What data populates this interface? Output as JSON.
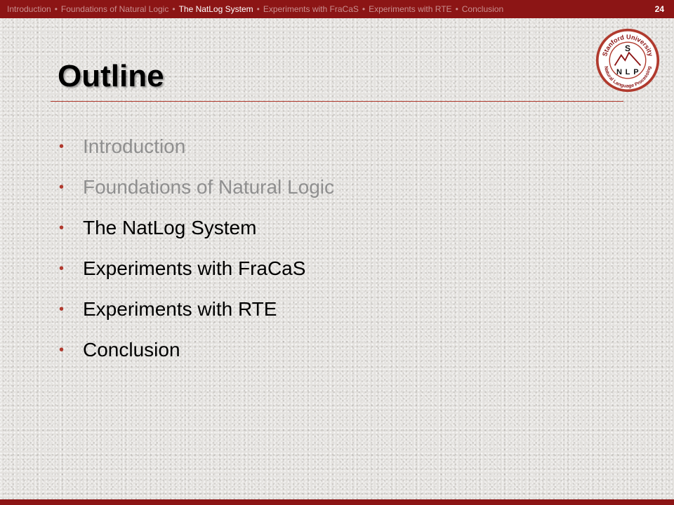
{
  "header": {
    "breadcrumbs": [
      {
        "label": "Introduction",
        "active": false
      },
      {
        "label": "Foundations of Natural Logic",
        "active": false
      },
      {
        "label": "The NatLog System",
        "active": true
      },
      {
        "label": "Experiments with FraCaS",
        "active": false
      },
      {
        "label": "Experiments with RTE",
        "active": false
      },
      {
        "label": "Conclusion",
        "active": false
      }
    ],
    "separator": "•",
    "slide_number": "24"
  },
  "logo": {
    "top_text": "Stanford University",
    "bottom_text": "Natural Language Processing",
    "letters": [
      "S",
      "N",
      "L",
      "P"
    ]
  },
  "slide": {
    "title": "Outline",
    "items": [
      {
        "label": "Introduction",
        "dimmed": true
      },
      {
        "label": "Foundations of Natural Logic",
        "dimmed": true
      },
      {
        "label": "The NatLog System",
        "dimmed": false
      },
      {
        "label": "Experiments with FraCaS",
        "dimmed": false
      },
      {
        "label": "Experiments with RTE",
        "dimmed": false
      },
      {
        "label": "Conclusion",
        "dimmed": false
      }
    ],
    "bullet": "•"
  },
  "colors": {
    "brand": "#8c1515",
    "accent": "#b03a2e",
    "dimmed_text": "#8f8f8f"
  }
}
